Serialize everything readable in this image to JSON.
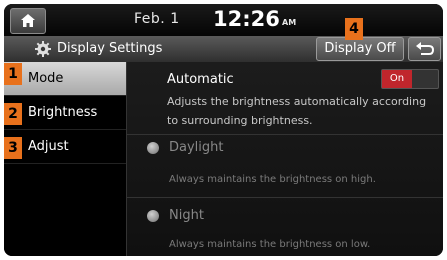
{
  "status": {
    "date": "Feb.  1",
    "time": "12:26",
    "ampm": "AM"
  },
  "titlebar": {
    "title": "Display Settings",
    "display_off_label": "Display Off"
  },
  "sidebar": {
    "items": [
      {
        "label": "Mode",
        "active": true
      },
      {
        "label": "Brightness",
        "active": false
      },
      {
        "label": "Adjust",
        "active": false
      }
    ]
  },
  "content": {
    "automatic": {
      "title": "Automatic",
      "toggle_label": "On",
      "description": "Adjusts the brightness automatically according to surrounding brightness."
    },
    "options": [
      {
        "label": "Daylight",
        "description": "Always maintains the brightness on high."
      },
      {
        "label": "Night",
        "description": "Always maintains the brightness on low."
      }
    ]
  },
  "callouts": [
    "1",
    "2",
    "3",
    "4"
  ],
  "colors": {
    "accent": "#e8711c",
    "toggle_on": "#c0262c"
  },
  "icons": [
    "home-icon",
    "gear-icon",
    "back-arrow-icon"
  ]
}
